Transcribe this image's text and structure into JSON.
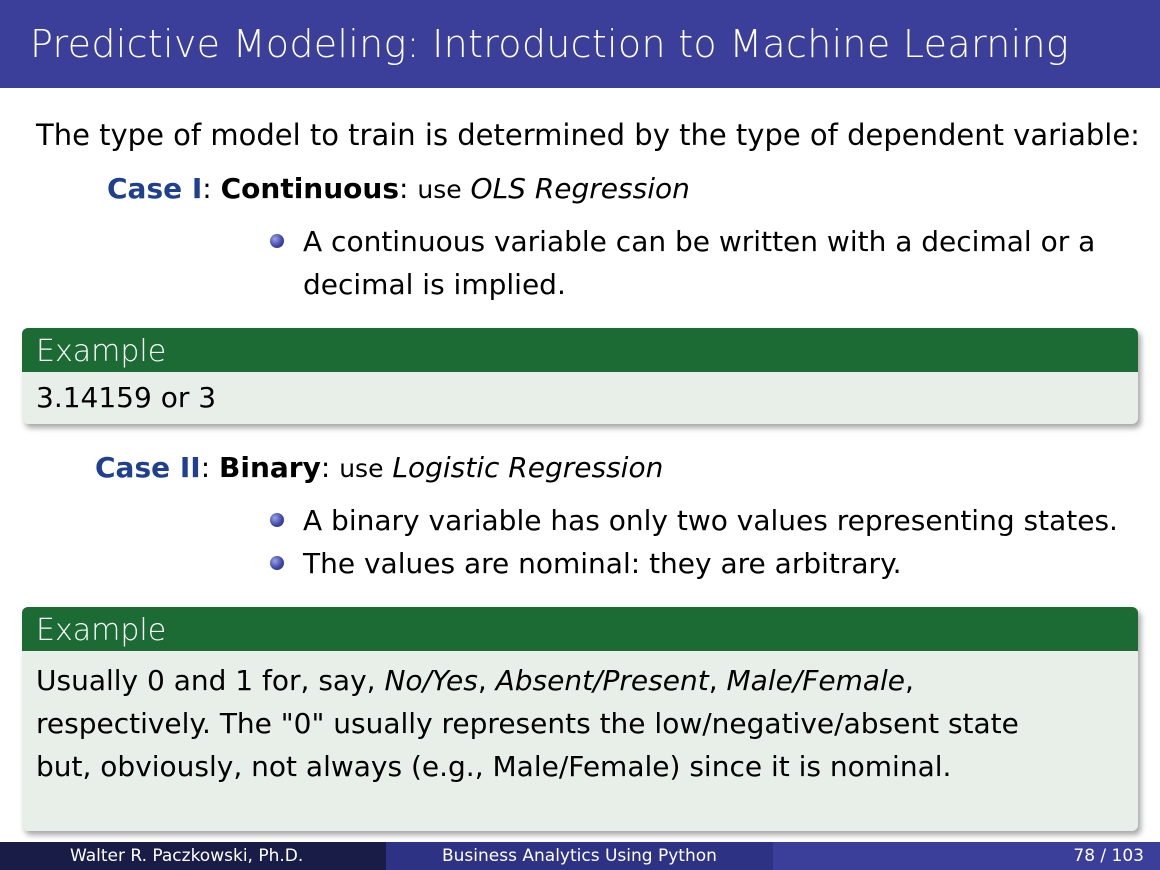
{
  "slide": {
    "title": "Predictive Modeling: Introduction to Machine Learning",
    "intro": "The type of model to train is determined by the type of dependent variable:"
  },
  "case1": {
    "label": "Case I",
    "term": "Continuous",
    "use": "use",
    "method": "OLS Regression",
    "bullets": [
      "A continuous variable can be written with a decimal or a decimal is implied."
    ]
  },
  "example1": {
    "header": "Example",
    "body": "3.14159 or 3"
  },
  "case2": {
    "label": "Case II",
    "term": "Binary",
    "use": "use",
    "method": "Logistic Regression",
    "bullets": [
      "A binary variable has only two values representing states.",
      "The values are nominal: they are arbitrary."
    ]
  },
  "example2": {
    "header": "Example",
    "line1_prefix": "Usually 0 and 1 for, say,",
    "pair1": "No/Yes",
    "pair2": "Absent/Present",
    "pair3": "Male/Female",
    "line2": "respectively. The \"0\" usually represents the low/negative/absent state",
    "line3": "but, obviously, not always (e.g., Male/Female) since it is nominal."
  },
  "footer": {
    "author": "Walter R. Paczkowski, Ph.D.",
    "course": "Business Analytics Using Python",
    "page": "78 / 103"
  }
}
